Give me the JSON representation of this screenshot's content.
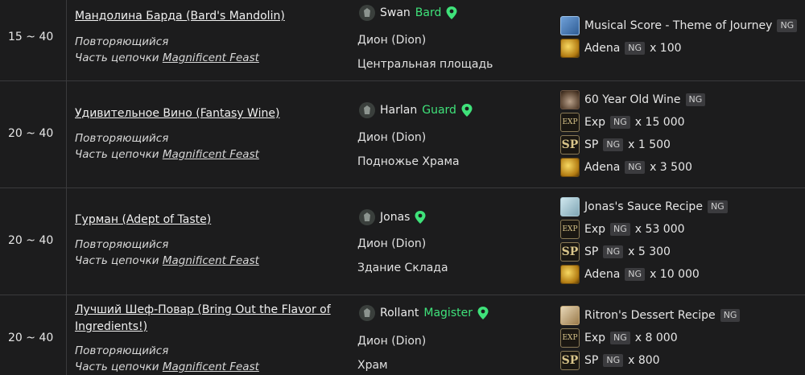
{
  "rows": [
    {
      "level": "15 ~ 40",
      "quest": "Мандолина Барда (Bard's Mandolin)",
      "repeat": "Повторяющийся",
      "chain_prefix": "Часть цепочки ",
      "chain": "Magnificent Feast",
      "npc": "Swan",
      "role": "Bard",
      "town": "Дион (Dion)",
      "place": "Центральная площадь",
      "rewards": [
        {
          "icon": "musical-score-icon",
          "name": "Musical Score - Theme of Journey",
          "ng": "NG",
          "qty": ""
        },
        {
          "icon": "adena-icon",
          "name": "Adena",
          "ng": "NG",
          "qty": "x 100"
        }
      ]
    },
    {
      "level": "20 ~ 40",
      "quest": "Удивительное Вино (Fantasy Wine)",
      "repeat": "Повторяющийся",
      "chain_prefix": "Часть цепочки ",
      "chain": "Magnificent Feast",
      "npc": "Harlan",
      "role": "Guard",
      "town": "Дион (Dion)",
      "place": "Подножье Храма",
      "rewards": [
        {
          "icon": "wine-icon",
          "name": "60 Year Old Wine",
          "ng": "NG",
          "qty": ""
        },
        {
          "icon": "exp-icon",
          "name": "Exp",
          "ng": "NG",
          "qty": "x 15 000"
        },
        {
          "icon": "sp-icon",
          "name": "SP",
          "ng": "NG",
          "qty": "x 1 500"
        },
        {
          "icon": "adena-icon",
          "name": "Adena",
          "ng": "NG",
          "qty": "x 3 500"
        }
      ]
    },
    {
      "level": "20 ~ 40",
      "quest": "Гурман (Adept of Taste)",
      "repeat": "Повторяющийся",
      "chain_prefix": "Часть цепочки ",
      "chain": "Magnificent Feast",
      "npc": "Jonas",
      "role": "",
      "town": "Дион (Dion)",
      "place": "Здание Склада",
      "rewards": [
        {
          "icon": "sauce-recipe-icon",
          "name": "Jonas's Sauce Recipe",
          "ng": "NG",
          "qty": ""
        },
        {
          "icon": "exp-icon",
          "name": "Exp",
          "ng": "NG",
          "qty": "x 53 000"
        },
        {
          "icon": "sp-icon",
          "name": "SP",
          "ng": "NG",
          "qty": "x 5 300"
        },
        {
          "icon": "adena-icon",
          "name": "Adena",
          "ng": "NG",
          "qty": "x 10 000"
        }
      ]
    },
    {
      "level": "20 ~ 40",
      "quest": "Лучший Шеф-Повар (Bring Out the Flavor of Ingredients!)",
      "repeat": "Повторяющийся",
      "chain_prefix": "Часть цепочки ",
      "chain": "Magnificent Feast",
      "npc": "Rollant",
      "role": "Magister",
      "town": "Дион (Dion)",
      "place": "Храм",
      "rewards": [
        {
          "icon": "dessert-recipe-icon",
          "name": "Ritron's Dessert Recipe",
          "ng": "NG",
          "qty": ""
        },
        {
          "icon": "exp-icon",
          "name": "Exp",
          "ng": "NG",
          "qty": "x 8 000"
        },
        {
          "icon": "sp-icon",
          "name": "SP",
          "ng": "NG",
          "qty": "x 800"
        }
      ]
    }
  ],
  "icon_labels": {
    "exp": "EXP",
    "sp": "SP"
  },
  "colors": {
    "role": "#3fe27a",
    "background": "#1c1c1d",
    "divider": "#3a3a3c"
  }
}
